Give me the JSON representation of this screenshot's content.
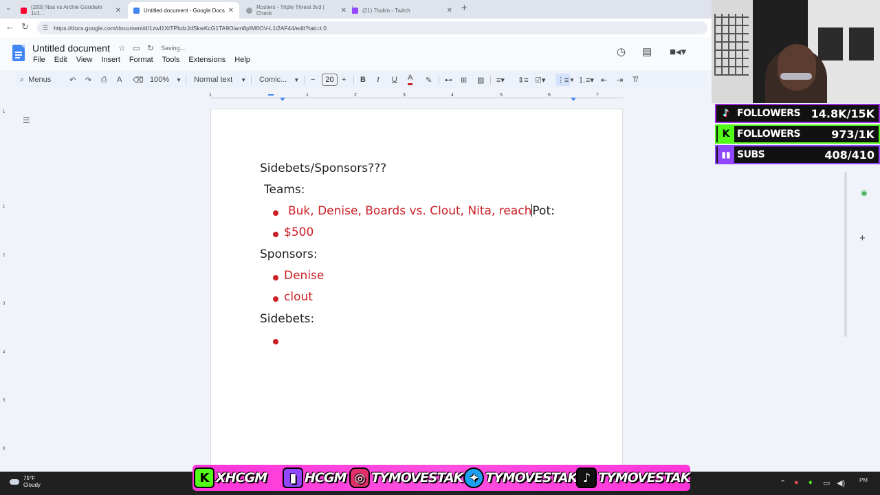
{
  "browser": {
    "tabs": [
      {
        "label": "(283) Nas vs Archie Goodwin 1v1...",
        "active": false
      },
      {
        "label": "Untitled document - Google Docs",
        "active": true
      },
      {
        "label": "Rosters - Triple Threat 3v3 | Check",
        "active": false
      },
      {
        "label": "(21) 7bukin - Twitch",
        "active": false
      }
    ],
    "url": "https://docs.google.com/document/d/1zwI1XtTPbdzJdSkwKcG1TA9Oiam8pIM6OV-L1i2AF44/edit?tab=t.0"
  },
  "docs": {
    "title": "Untitled document",
    "save_status": "Saving...",
    "menu": [
      "File",
      "Edit",
      "View",
      "Insert",
      "Format",
      "Tools",
      "Extensions",
      "Help"
    ],
    "toolbar": {
      "menus_label": "Menus",
      "zoom": "100%",
      "style": "Normal text",
      "font": "Comic...",
      "font_size": "20"
    },
    "ruler_numbers": [
      "1",
      "1",
      "2",
      "3",
      "4",
      "5",
      "6",
      "7"
    ],
    "vruler_numbers": [
      "1",
      "1",
      "2",
      "3",
      "4",
      "5",
      "6"
    ]
  },
  "document": {
    "heading": "Sidebets/Sponsors???",
    "teams_label": "Teams:",
    "teams_item": "Buk, Denise, Boards vs. Clout, Nita, reach",
    "pot_text": "Pot:",
    "amount": "$500",
    "sponsors_label": "Sponsors:",
    "sponsors": [
      "Denise",
      "clout"
    ],
    "sidebets_label": "Sidebets:"
  },
  "overlay": {
    "tiktok": {
      "label": "FOLLOWERS",
      "value": "14.8K/15K"
    },
    "kick": {
      "label": "FOLLOWERS",
      "value": "973/1K"
    },
    "twitch": {
      "label": "SUBS",
      "value": "408/410"
    },
    "socials": [
      "XHCGM",
      "HCGM",
      "TYMOVESTAK",
      "TYMOVESTAK",
      "TYMOVESTAK"
    ]
  },
  "taskbar": {
    "temperature": "75°F",
    "condition": "Cloudy",
    "clock": "PM"
  },
  "colors": {
    "doc_red": "#cc1f26",
    "kick_green": "#53fc18",
    "twitch_purple": "#9146ff",
    "banner_pink": "#ff4fe0"
  }
}
